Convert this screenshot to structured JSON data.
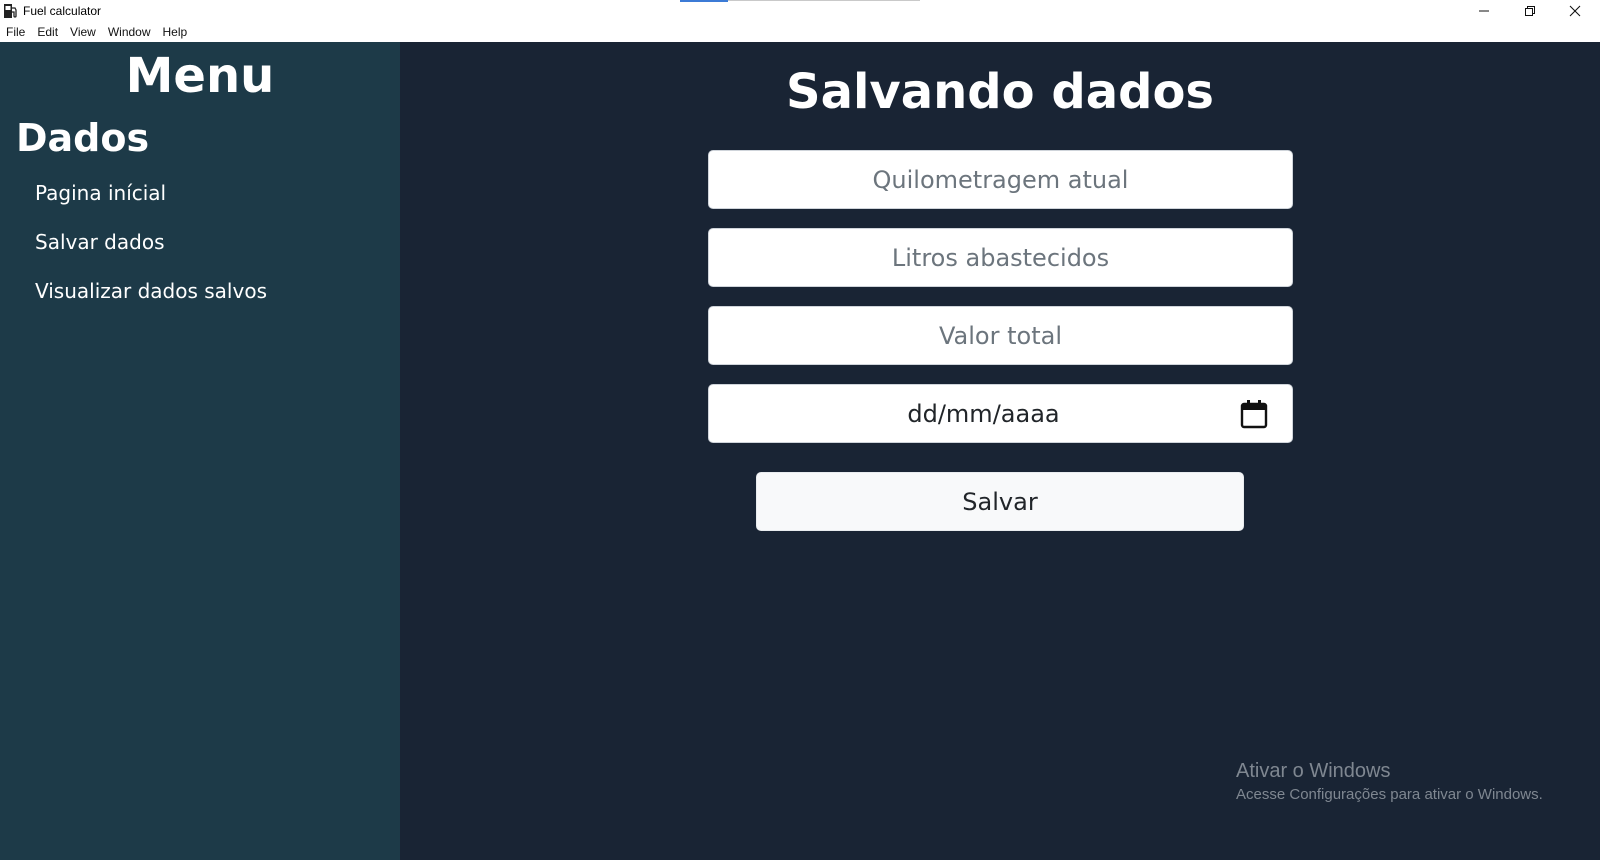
{
  "window": {
    "title": "Fuel calculator",
    "controls": {
      "minimize_icon": "minimize-icon",
      "maximize_icon": "restore-icon",
      "close_icon": "close-icon"
    }
  },
  "menubar": {
    "items": [
      "File",
      "Edit",
      "View",
      "Window",
      "Help"
    ]
  },
  "sidebar": {
    "title": "Menu",
    "section": "Dados",
    "items": [
      {
        "label": "Pagina inícial"
      },
      {
        "label": "Salvar dados"
      },
      {
        "label": "Visualizar dados salvos"
      }
    ],
    "background": "#1d3a48"
  },
  "main": {
    "title": "Salvando dados",
    "fields": {
      "odometer": {
        "placeholder": "Quilometragem atual"
      },
      "liters": {
        "placeholder": "Litros abastecidos"
      },
      "total": {
        "placeholder": "Valor total"
      },
      "date": {
        "value": "dd/mm/aaaa",
        "icon": "calendar-icon"
      }
    },
    "save_label": "Salvar",
    "background": "#192434"
  },
  "watermark": {
    "line1": "Ativar o Windows",
    "line2": "Acesse Configurações para ativar o Windows."
  }
}
